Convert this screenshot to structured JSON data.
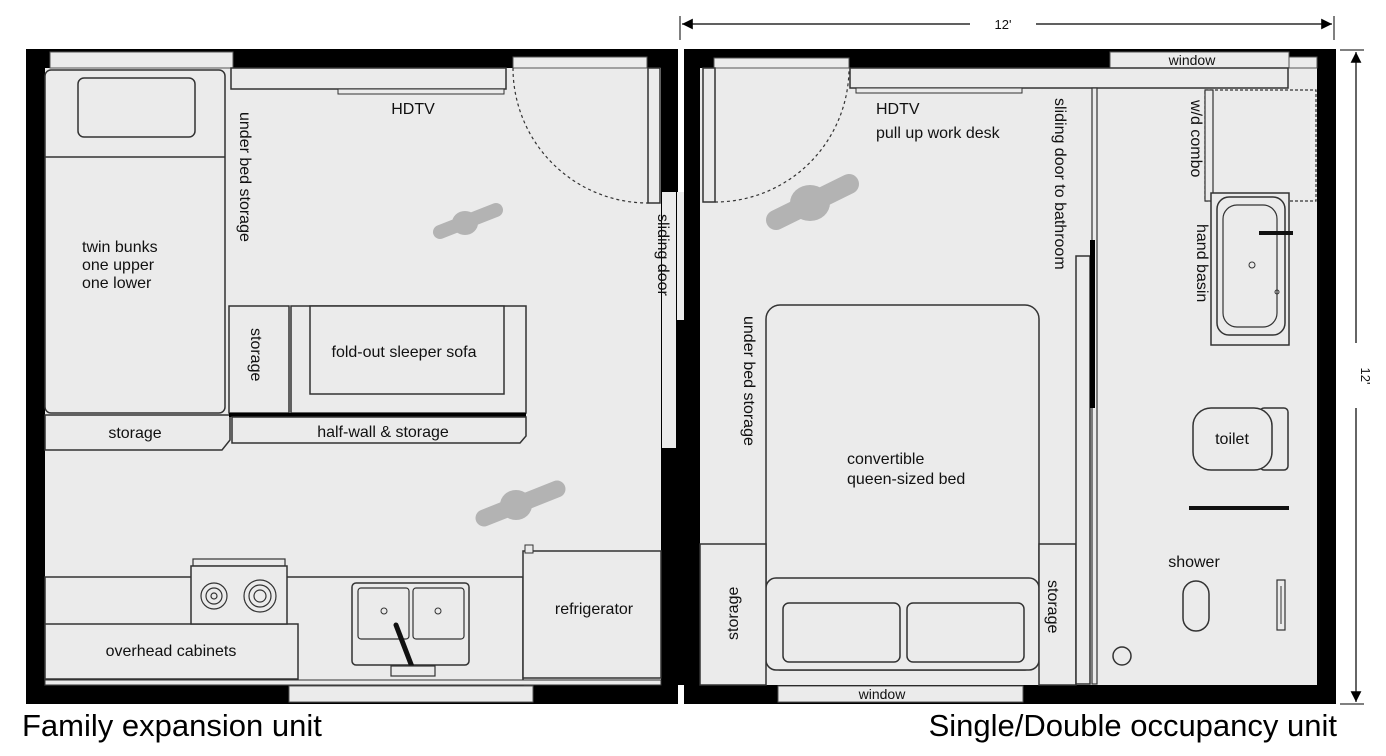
{
  "dimensions": {
    "width": "12'",
    "height": "12'"
  },
  "family_unit": {
    "title": "Family expansion unit",
    "labels": {
      "hdtv": "HDTV",
      "under_bed_storage": "under bed storage",
      "twin_bunks": [
        "twin bunks",
        "one upper",
        "one lower"
      ],
      "storage_vertical": "storage",
      "sleeper_sofa": "fold-out sleeper sofa",
      "storage_bottom": "storage",
      "half_wall": "half-wall & storage",
      "refrigerator": "refrigerator",
      "overhead_cabinets": "overhead cabinets"
    }
  },
  "sliding_door": "sliding door",
  "single_unit": {
    "title": "Single/Double occupancy unit",
    "labels": {
      "hdtv": "HDTV",
      "work_desk": "pull up work desk",
      "sliding_door_bathroom": "sliding door to bathroom",
      "under_bed_storage": "under bed storage",
      "bed": [
        "convertible",
        "queen-sized bed"
      ],
      "storage_left": "storage",
      "storage_right": "storage",
      "window_top": "window",
      "window_bottom": "window",
      "wd_combo": "w/d combo",
      "hand_basin": "hand basin",
      "toilet": "toilet",
      "shower": "shower"
    }
  },
  "colors": {
    "wall": "#000000",
    "floor": "#ebebeb",
    "outline": "#333333",
    "footprint": "#b3b3b3"
  }
}
